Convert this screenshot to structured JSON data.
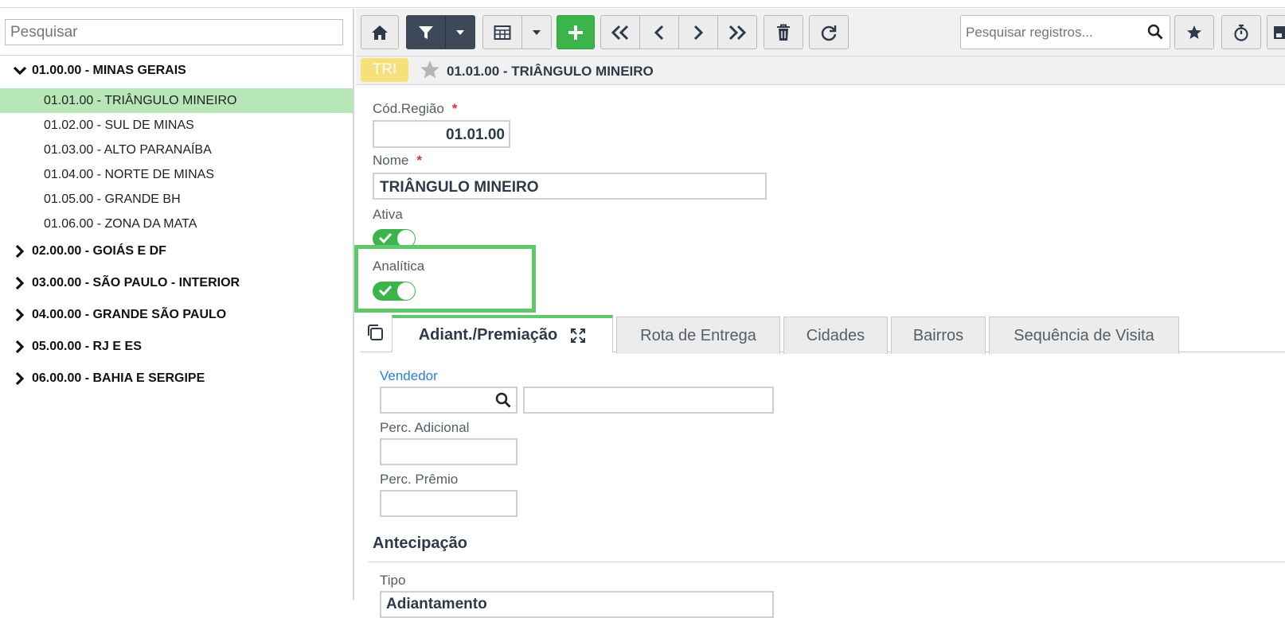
{
  "left_panel": {
    "search_placeholder": "Pesquisar",
    "tree": [
      {
        "label": "01.00.00 - MINAS GERAIS",
        "expanded": true,
        "children": [
          {
            "label": "01.01.00 - TRIÂNGULO MINEIRO",
            "selected": true
          },
          {
            "label": "01.02.00 - SUL DE MINAS"
          },
          {
            "label": "01.03.00 - ALTO PARANAÍBA"
          },
          {
            "label": "01.04.00 - NORTE DE MINAS"
          },
          {
            "label": "01.05.00 - GRANDE BH"
          },
          {
            "label": "01.06.00 - ZONA DA MATA"
          }
        ]
      },
      {
        "label": "02.00.00 - GOIÁS E DF",
        "expanded": false
      },
      {
        "label": "03.00.00 - SÃO PAULO - INTERIOR",
        "expanded": false
      },
      {
        "label": "04.00.00 - GRANDE SÃO PAULO",
        "expanded": false
      },
      {
        "label": "05.00.00 - RJ E ES",
        "expanded": false
      },
      {
        "label": "06.00.00 - BAHIA E SERGIPE",
        "expanded": false
      }
    ]
  },
  "toolbar": {
    "search_placeholder": "Pesquisar registros...",
    "icons": [
      "home-icon",
      "filter-icon",
      "caret-down-icon",
      "table-icon",
      "caret-down-icon",
      "plus-icon",
      "double-chevron-left-icon",
      "chevron-left-icon",
      "chevron-right-icon",
      "double-chevron-right-icon",
      "trash-icon",
      "refresh-icon",
      "search-icon",
      "star-icon",
      "stopwatch-icon",
      "save-icon"
    ]
  },
  "record": {
    "badge": "TRI",
    "title": "01.01.00 - TRIÂNGULO MINEIRO"
  },
  "form": {
    "cod_regiao_label": "Cód.Região",
    "cod_regiao_value": "01.01.00",
    "nome_label": "Nome",
    "nome_value": "TRIÂNGULO MINEIRO",
    "required_mark": "*",
    "ativa_label": "Ativa",
    "ativa_on": true,
    "analitica_label": "Analítica",
    "analitica_on": true
  },
  "tabs": [
    {
      "label": "Adiant./Premiação",
      "active": true
    },
    {
      "label": "Rota de Entrega"
    },
    {
      "label": "Cidades"
    },
    {
      "label": "Bairros"
    },
    {
      "label": "Sequência de Visita"
    }
  ],
  "tab_content": {
    "vendedor_label": "Vendedor",
    "vendedor_code": "",
    "vendedor_name": "",
    "perc_adicional_label": "Perc. Adicional",
    "perc_adicional_value": "",
    "perc_premio_label": "Perc. Prêmio",
    "perc_premio_value": "",
    "antecipacao_title": "Antecipação",
    "tipo_label": "Tipo",
    "tipo_value": "Adiantamento"
  },
  "colors": {
    "accent_green": "#3bb54a",
    "selected_row": "#b7e6b7",
    "highlight": "#5fc86a",
    "dark_button": "#3d4858",
    "badge": "#f7e07a"
  }
}
